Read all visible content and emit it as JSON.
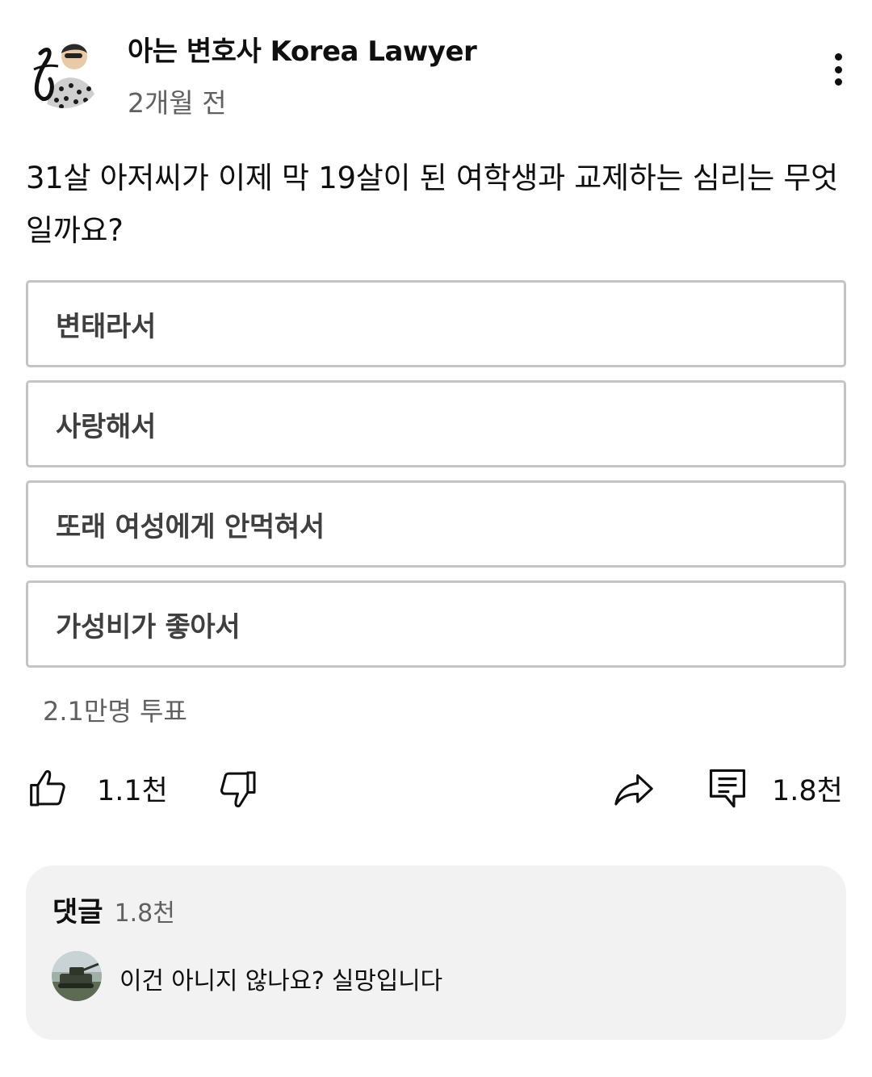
{
  "post": {
    "channel_name": "아는 변호사 Korea Lawyer",
    "time": "2개월 전",
    "avatar_icon": "channel-avatar-icon",
    "more_icon": "more-vert-icon"
  },
  "poll": {
    "question": "31살 아저씨가 이제 막 19살이 된 여학생과 교제하는 심리는 무엇일까요?",
    "options": [
      {
        "label": "변태라서"
      },
      {
        "label": "사랑해서"
      },
      {
        "label": "또래 여성에게 안먹혀서"
      },
      {
        "label": "가성비가 좋아서"
      }
    ],
    "votes": "2.1만명 투표"
  },
  "actions": {
    "like_count": "1.1천",
    "comment_count": "1.8천",
    "icons": [
      "thumbs-up-icon",
      "thumbs-down-icon",
      "share-icon",
      "comment-icon"
    ]
  },
  "comments": {
    "title": "댓글",
    "count": "1.8천",
    "top_comment": {
      "text": "이건 아니지 않나요? 실망입니다"
    }
  },
  "colors": {
    "text_primary": "#0f0f0f",
    "text_secondary": "#606060",
    "option_border": "#c4c4c4",
    "comments_bg": "#f2f2f2"
  }
}
